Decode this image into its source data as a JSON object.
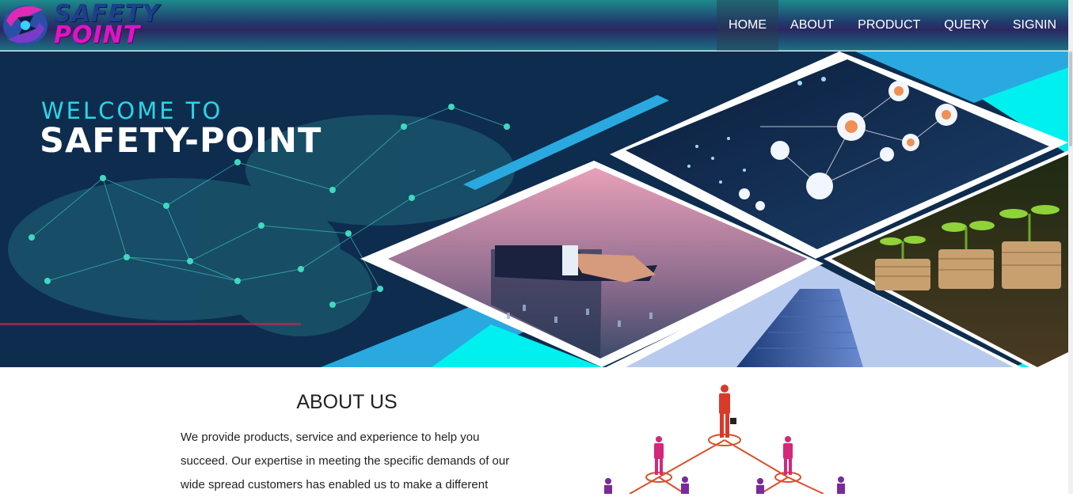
{
  "logo": {
    "line1": "SAFETY",
    "line2": "POINT"
  },
  "nav": {
    "items": [
      {
        "label": "HOME",
        "active": true
      },
      {
        "label": "ABOUT",
        "active": false
      },
      {
        "label": "PRODUCT",
        "active": false
      },
      {
        "label": "QUERY",
        "active": false
      },
      {
        "label": "SIGNIN",
        "active": false
      }
    ]
  },
  "hero": {
    "welcome": "WELCOME TO",
    "brand": "SAFETY-POINT"
  },
  "about": {
    "title": "ABOUT US",
    "text": "We provide products, service and experience to help you succeed. Our expertise in meeting the specific demands of our wide spread customers has enabled us to make a different"
  },
  "colors": {
    "nav_teal": "#1d8a8c",
    "nav_purple": "#2a2860",
    "hero_navy": "#0e2c4e",
    "accent_cyan": "#00f0f0",
    "accent_blue": "#29a9e0",
    "logo_magenta": "#e013c8"
  }
}
